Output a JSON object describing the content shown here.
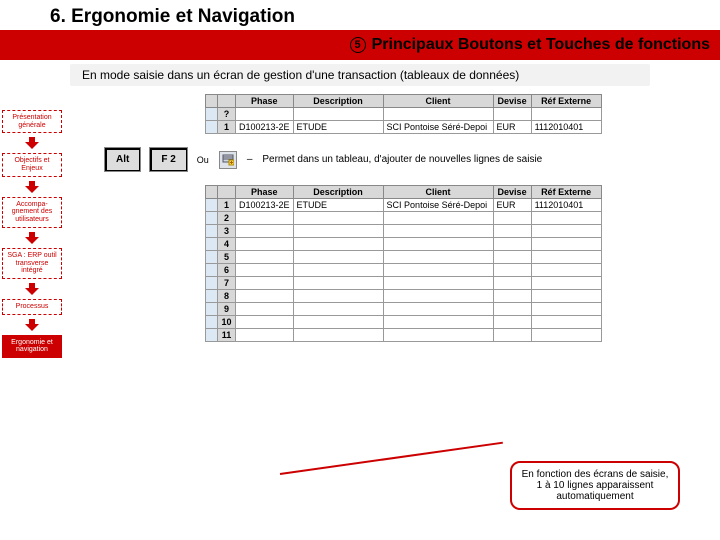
{
  "header": {
    "title": "6. Ergonomie et Navigation"
  },
  "subheader": {
    "num": "5",
    "text": "Principaux Boutons et Touches de fonctions"
  },
  "context": "En mode saisie dans un écran de gestion d'une transaction (tableaux de données)",
  "sidebar": {
    "items": [
      {
        "label": "Présentation générale"
      },
      {
        "label": "Objectifs et Enjeux"
      },
      {
        "label": "Accompa-gnement des utilisateurs"
      },
      {
        "label": "SGA : ERP outil transverse intégré"
      },
      {
        "label": "Processus"
      },
      {
        "label": "Ergonomie et navigation"
      }
    ]
  },
  "keys": {
    "alt": "Alt",
    "f2": "F 2",
    "ou": "Ou",
    "dash": "–",
    "explain": "Permet dans un tableau, d'ajouter de nouvelles lignes de saisie"
  },
  "table1": {
    "cols": [
      "Phase",
      "Description",
      "Client",
      "Devise",
      "Réf Externe"
    ],
    "rownums": [
      "?",
      "1"
    ],
    "row": [
      "D100213-2E",
      "ETUDE",
      "SCI Pontoise Séré-Depoi",
      "EUR",
      "1112010401"
    ]
  },
  "table2": {
    "cols": [
      "Phase",
      "Description",
      "Client",
      "Devise",
      "Réf Externe"
    ],
    "rownums": [
      "1",
      "2",
      "3",
      "4",
      "5",
      "6",
      "7",
      "8",
      "9",
      "10",
      "11"
    ],
    "row": [
      "D100213-2E",
      "ETUDE",
      "SCI Pontoise Séré-Depoi",
      "EUR",
      "1112010401"
    ]
  },
  "callout": "En fonction des écrans de saisie, 1 à 10 lignes apparaissent automatiquement"
}
